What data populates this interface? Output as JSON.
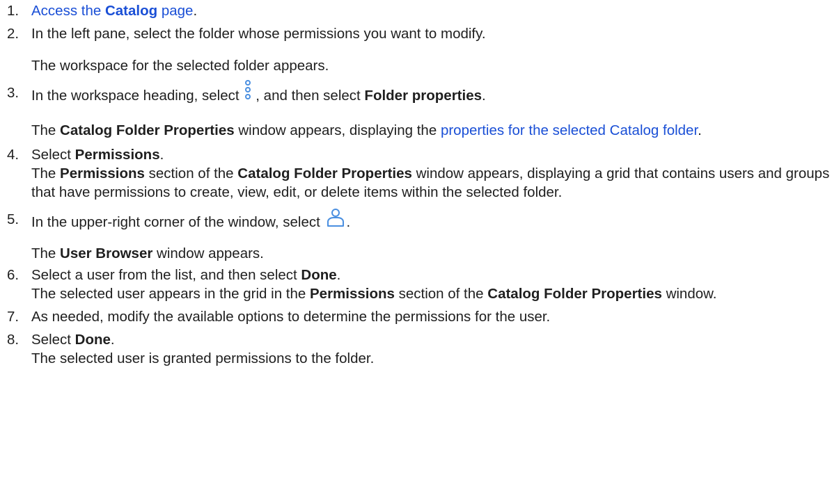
{
  "steps": [
    {
      "num": "1.",
      "link_prefix": "Access the ",
      "link_bold": "Catalog",
      "link_suffix": " page",
      "after_link": "."
    },
    {
      "num": "2.",
      "text": "In the left pane, select the folder whose permissions you want to modify.",
      "result": "The workspace for the selected folder appears."
    },
    {
      "num": "3.",
      "text_a": "In the workspace heading, select ",
      "icon": "more-vertical-icon",
      "text_b": ", and then select ",
      "bold": "Folder properties",
      "text_c": ".",
      "result_a": "The ",
      "result_bold": "Catalog Folder Properties",
      "result_b": " window appears, displaying the ",
      "result_link": "properties for the selected Catalog folder",
      "result_c": "."
    },
    {
      "num": "4.",
      "text_a": "Select ",
      "bold": "Permissions",
      "text_b": ".",
      "result_a": "The ",
      "result_bold1": "Permissions",
      "result_b": " section of the ",
      "result_bold2": "Catalog Folder Properties",
      "result_c": " window appears, displaying a grid that contains users and groups that have permissions to create, view, edit, or delete items within the selected folder."
    },
    {
      "num": "5.",
      "text_a": "In the upper-right corner of the window, select ",
      "icon": "user-icon",
      "text_b": ".",
      "result_a": "The ",
      "result_bold": "User Browser",
      "result_b": " window appears."
    },
    {
      "num": "6.",
      "text_a": "Select a user from the list, and then select ",
      "bold": "Done",
      "text_b": ".",
      "result_a": "The selected user appears in the grid in the ",
      "result_bold1": "Permissions",
      "result_b": " section of the ",
      "result_bold2": "Catalog Folder Properties",
      "result_c": " window."
    },
    {
      "num": "7.",
      "text": "As needed, modify the available options to determine the permissions for the user."
    },
    {
      "num": "8.",
      "text_a": "Select ",
      "bold": "Done",
      "text_b": ".",
      "result": "The selected user is granted permissions to the folder."
    }
  ],
  "colors": {
    "text": "#1f1f1f",
    "link": "#1a4fd6",
    "icon": "#4a8fe0"
  }
}
